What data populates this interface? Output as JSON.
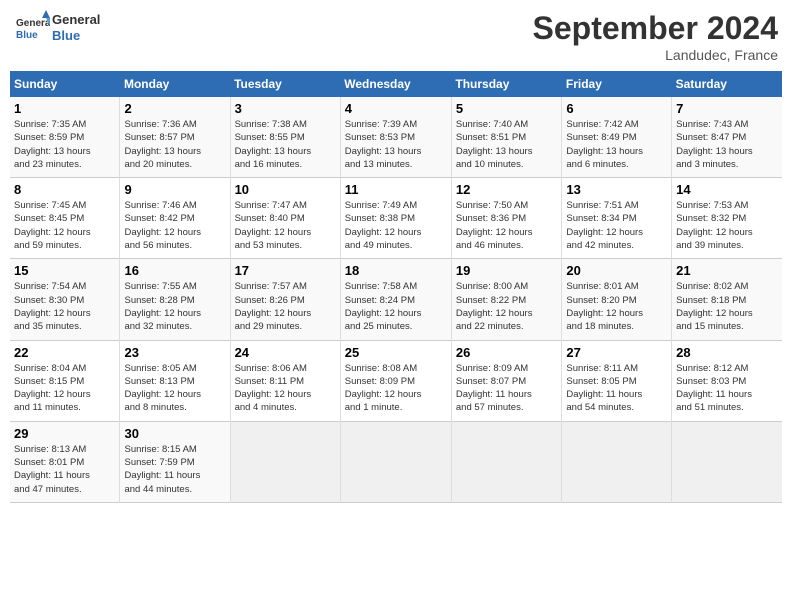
{
  "header": {
    "logo_line1": "General",
    "logo_line2": "Blue",
    "title": "September 2024",
    "location": "Landudec, France"
  },
  "columns": [
    "Sunday",
    "Monday",
    "Tuesday",
    "Wednesday",
    "Thursday",
    "Friday",
    "Saturday"
  ],
  "weeks": [
    [
      {
        "day": "1",
        "info": "Sunrise: 7:35 AM\nSunset: 8:59 PM\nDaylight: 13 hours\nand 23 minutes."
      },
      {
        "day": "2",
        "info": "Sunrise: 7:36 AM\nSunset: 8:57 PM\nDaylight: 13 hours\nand 20 minutes."
      },
      {
        "day": "3",
        "info": "Sunrise: 7:38 AM\nSunset: 8:55 PM\nDaylight: 13 hours\nand 16 minutes."
      },
      {
        "day": "4",
        "info": "Sunrise: 7:39 AM\nSunset: 8:53 PM\nDaylight: 13 hours\nand 13 minutes."
      },
      {
        "day": "5",
        "info": "Sunrise: 7:40 AM\nSunset: 8:51 PM\nDaylight: 13 hours\nand 10 minutes."
      },
      {
        "day": "6",
        "info": "Sunrise: 7:42 AM\nSunset: 8:49 PM\nDaylight: 13 hours\nand 6 minutes."
      },
      {
        "day": "7",
        "info": "Sunrise: 7:43 AM\nSunset: 8:47 PM\nDaylight: 13 hours\nand 3 minutes."
      }
    ],
    [
      {
        "day": "8",
        "info": "Sunrise: 7:45 AM\nSunset: 8:45 PM\nDaylight: 12 hours\nand 59 minutes."
      },
      {
        "day": "9",
        "info": "Sunrise: 7:46 AM\nSunset: 8:42 PM\nDaylight: 12 hours\nand 56 minutes."
      },
      {
        "day": "10",
        "info": "Sunrise: 7:47 AM\nSunset: 8:40 PM\nDaylight: 12 hours\nand 53 minutes."
      },
      {
        "day": "11",
        "info": "Sunrise: 7:49 AM\nSunset: 8:38 PM\nDaylight: 12 hours\nand 49 minutes."
      },
      {
        "day": "12",
        "info": "Sunrise: 7:50 AM\nSunset: 8:36 PM\nDaylight: 12 hours\nand 46 minutes."
      },
      {
        "day": "13",
        "info": "Sunrise: 7:51 AM\nSunset: 8:34 PM\nDaylight: 12 hours\nand 42 minutes."
      },
      {
        "day": "14",
        "info": "Sunrise: 7:53 AM\nSunset: 8:32 PM\nDaylight: 12 hours\nand 39 minutes."
      }
    ],
    [
      {
        "day": "15",
        "info": "Sunrise: 7:54 AM\nSunset: 8:30 PM\nDaylight: 12 hours\nand 35 minutes."
      },
      {
        "day": "16",
        "info": "Sunrise: 7:55 AM\nSunset: 8:28 PM\nDaylight: 12 hours\nand 32 minutes."
      },
      {
        "day": "17",
        "info": "Sunrise: 7:57 AM\nSunset: 8:26 PM\nDaylight: 12 hours\nand 29 minutes."
      },
      {
        "day": "18",
        "info": "Sunrise: 7:58 AM\nSunset: 8:24 PM\nDaylight: 12 hours\nand 25 minutes."
      },
      {
        "day": "19",
        "info": "Sunrise: 8:00 AM\nSunset: 8:22 PM\nDaylight: 12 hours\nand 22 minutes."
      },
      {
        "day": "20",
        "info": "Sunrise: 8:01 AM\nSunset: 8:20 PM\nDaylight: 12 hours\nand 18 minutes."
      },
      {
        "day": "21",
        "info": "Sunrise: 8:02 AM\nSunset: 8:18 PM\nDaylight: 12 hours\nand 15 minutes."
      }
    ],
    [
      {
        "day": "22",
        "info": "Sunrise: 8:04 AM\nSunset: 8:15 PM\nDaylight: 12 hours\nand 11 minutes."
      },
      {
        "day": "23",
        "info": "Sunrise: 8:05 AM\nSunset: 8:13 PM\nDaylight: 12 hours\nand 8 minutes."
      },
      {
        "day": "24",
        "info": "Sunrise: 8:06 AM\nSunset: 8:11 PM\nDaylight: 12 hours\nand 4 minutes."
      },
      {
        "day": "25",
        "info": "Sunrise: 8:08 AM\nSunset: 8:09 PM\nDaylight: 12 hours\nand 1 minute."
      },
      {
        "day": "26",
        "info": "Sunrise: 8:09 AM\nSunset: 8:07 PM\nDaylight: 11 hours\nand 57 minutes."
      },
      {
        "day": "27",
        "info": "Sunrise: 8:11 AM\nSunset: 8:05 PM\nDaylight: 11 hours\nand 54 minutes."
      },
      {
        "day": "28",
        "info": "Sunrise: 8:12 AM\nSunset: 8:03 PM\nDaylight: 11 hours\nand 51 minutes."
      }
    ],
    [
      {
        "day": "29",
        "info": "Sunrise: 8:13 AM\nSunset: 8:01 PM\nDaylight: 11 hours\nand 47 minutes."
      },
      {
        "day": "30",
        "info": "Sunrise: 8:15 AM\nSunset: 7:59 PM\nDaylight: 11 hours\nand 44 minutes."
      },
      {
        "day": "",
        "info": ""
      },
      {
        "day": "",
        "info": ""
      },
      {
        "day": "",
        "info": ""
      },
      {
        "day": "",
        "info": ""
      },
      {
        "day": "",
        "info": ""
      }
    ]
  ]
}
